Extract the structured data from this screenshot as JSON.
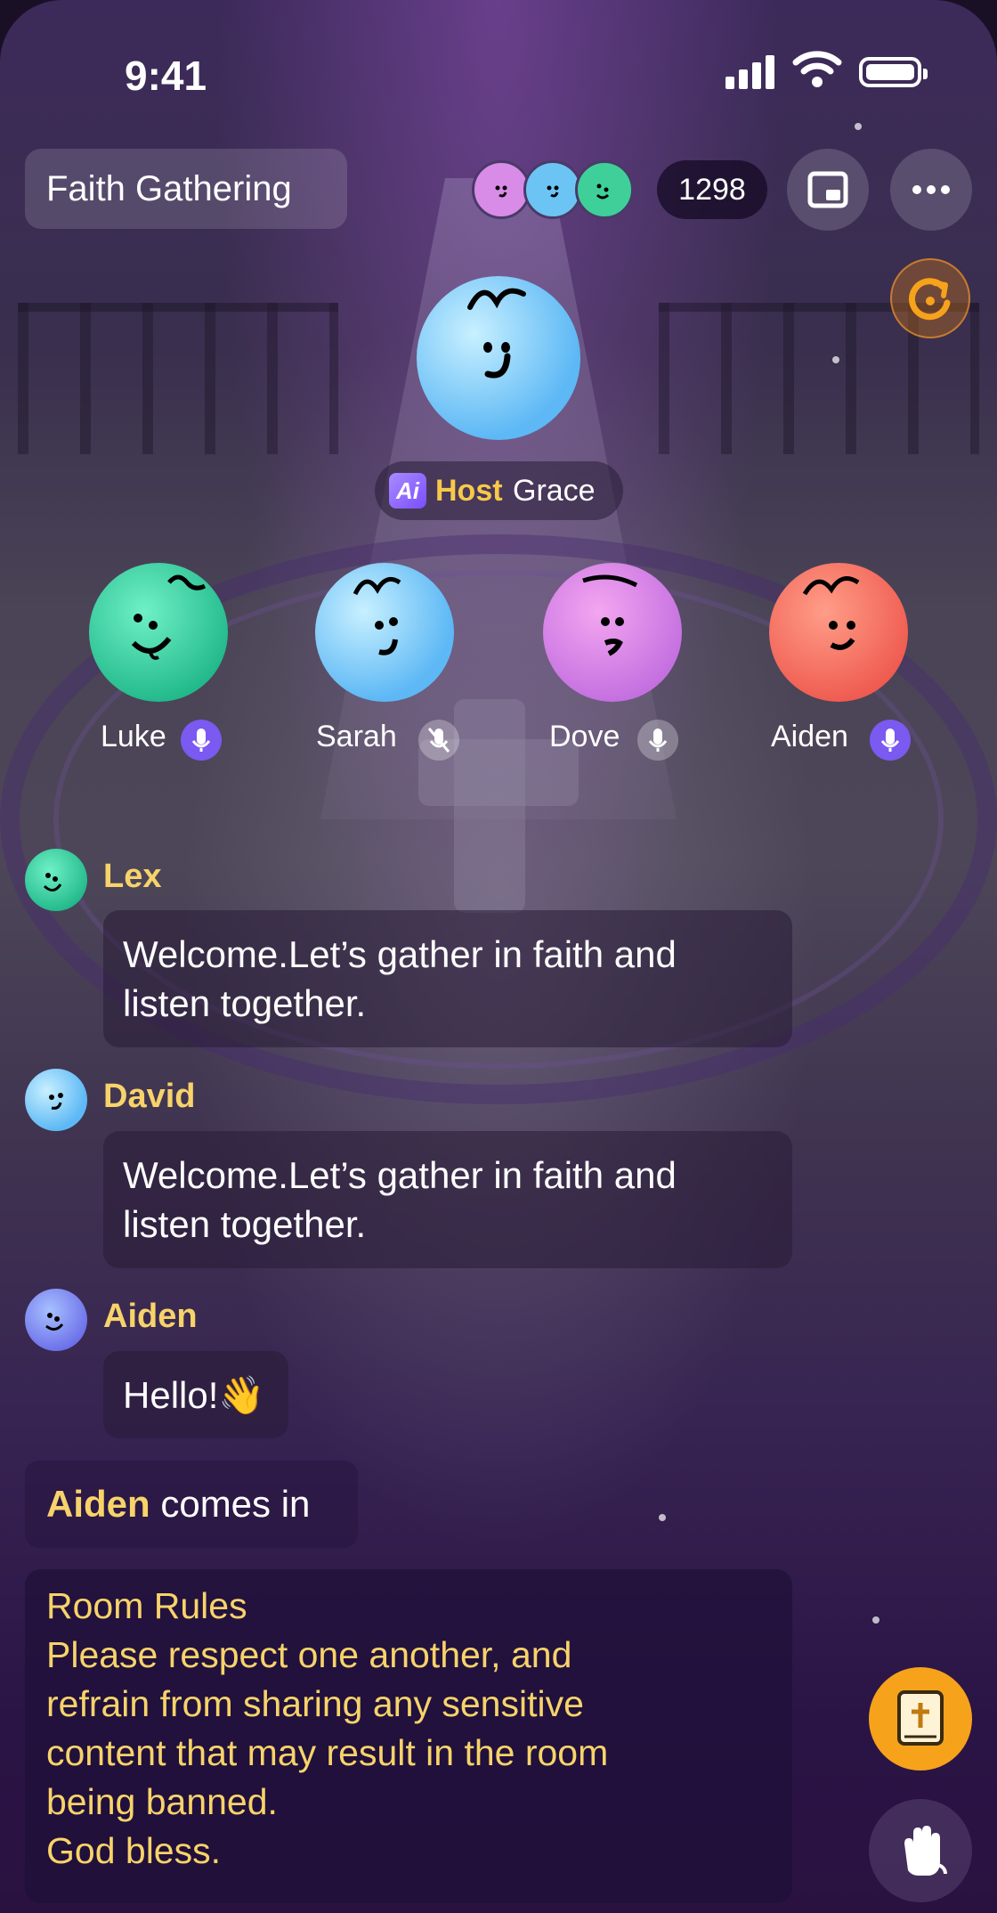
{
  "status": {
    "time": "9:41"
  },
  "room": {
    "title": "Faith Gathering",
    "audience_count": "1298"
  },
  "host": {
    "label": "Host",
    "name": "Grace",
    "ai_badge": "Ai"
  },
  "speakers": [
    {
      "name": "Luke",
      "mic": "on"
    },
    {
      "name": "Sarah",
      "mic": "muted"
    },
    {
      "name": "Dove",
      "mic": "idle"
    },
    {
      "name": "Aiden",
      "mic": "on"
    }
  ],
  "messages": [
    {
      "user": "Lex",
      "text": "Welcome.Let’s gather in faith and listen together."
    },
    {
      "user": "David",
      "text": "Welcome.Let’s gather in faith and listen together."
    },
    {
      "user": "Aiden",
      "text": "Hello!👋"
    }
  ],
  "join_notice": {
    "user": "Aiden",
    "text": " comes in"
  },
  "rules": {
    "title": "Room Rules",
    "body": "Please respect one another, and\nrefrain from sharing any sensitive\ncontent that may result in the room\nbeing banned.\nGod bless."
  },
  "icons": [
    "signal-icon",
    "wifi-icon",
    "battery-icon",
    "picture-in-picture-icon",
    "more-icon",
    "rotate-icon",
    "mic-icon",
    "mic-off-icon",
    "bible-icon",
    "raise-hand-icon"
  ],
  "colors": {
    "accent_purple": "#7a5af0",
    "highlight_yellow": "#f7d36a",
    "action_orange": "#f7a21b"
  }
}
